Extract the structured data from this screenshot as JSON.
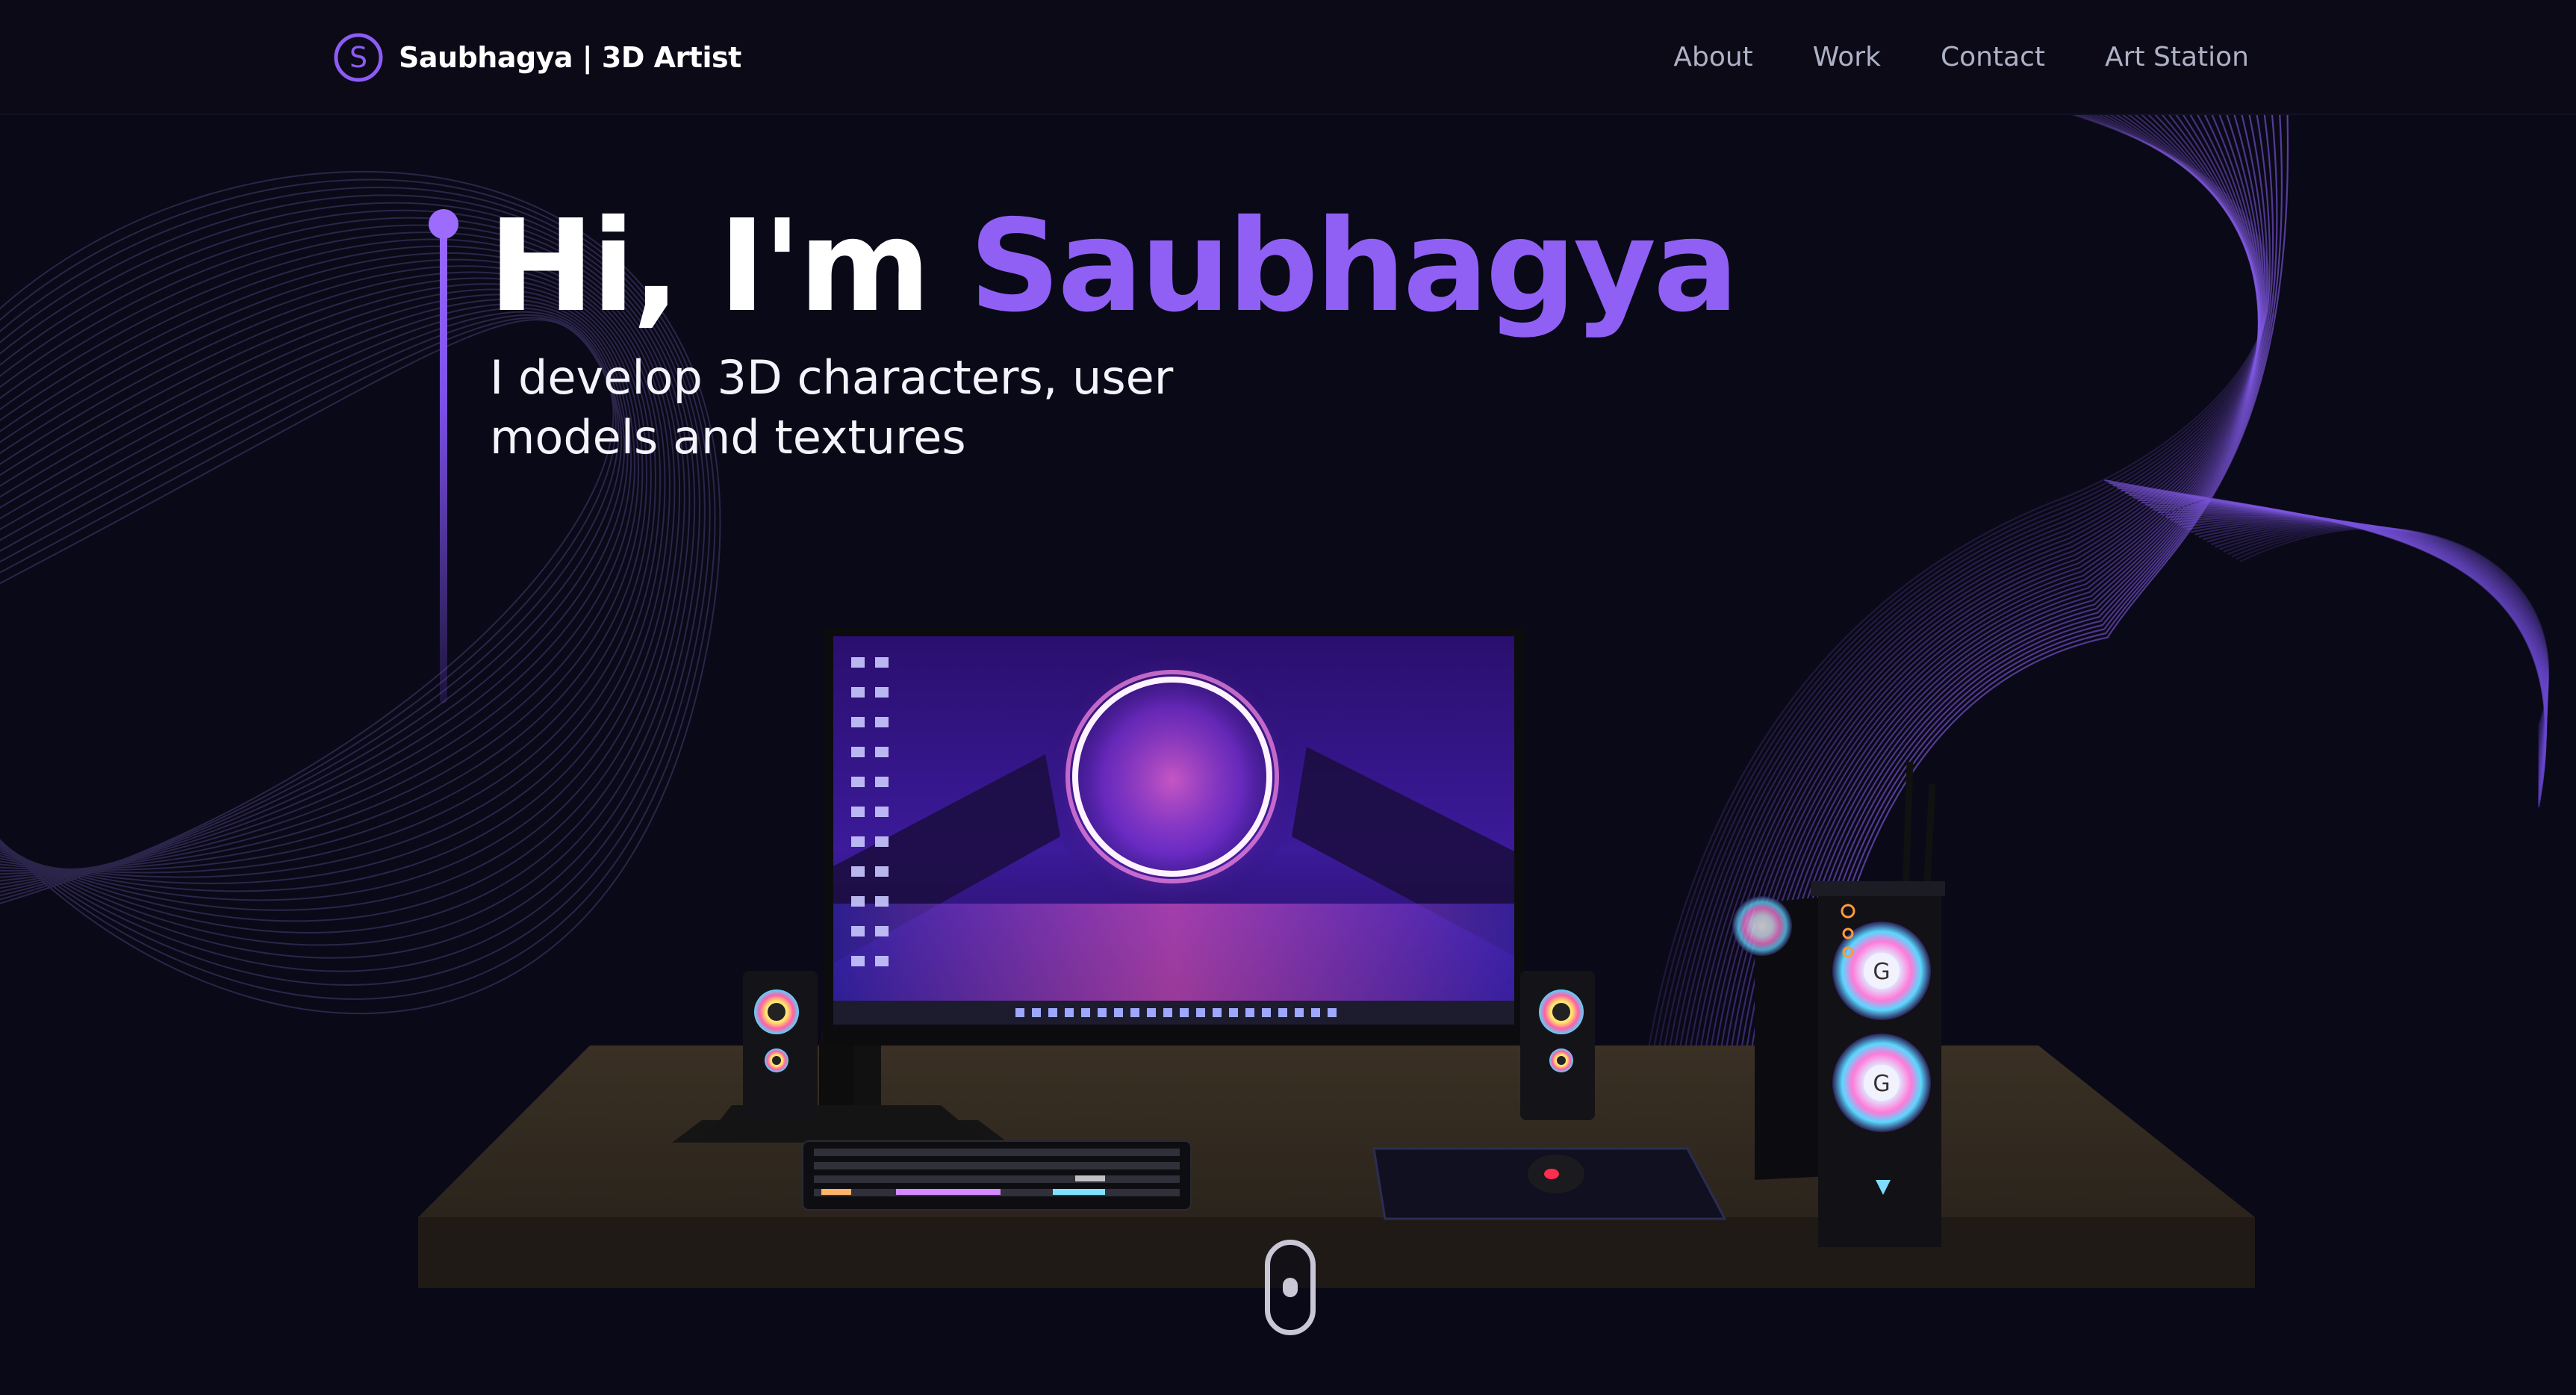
{
  "brand": {
    "logo_letter": "S",
    "name": "Saubhagya | 3D Artist"
  },
  "nav": {
    "items": [
      "About",
      "Work",
      "Contact",
      "Art Station"
    ]
  },
  "hero": {
    "greeting": "Hi, I'm",
    "name": "Saubhagya",
    "subtitle": "I develop 3D characters, user models and textures"
  },
  "scene": {
    "icons": [
      "monitor-icon",
      "keyboard-icon",
      "mouse-icon",
      "speaker-icon",
      "pc-case-icon"
    ]
  },
  "scroll_indicator": {
    "icon": "mouse-scroll-icon"
  },
  "colors": {
    "background": "#0a0917",
    "accent": "#9060f5",
    "nav_text": "#aeb1c6",
    "text": "#ffffff"
  }
}
